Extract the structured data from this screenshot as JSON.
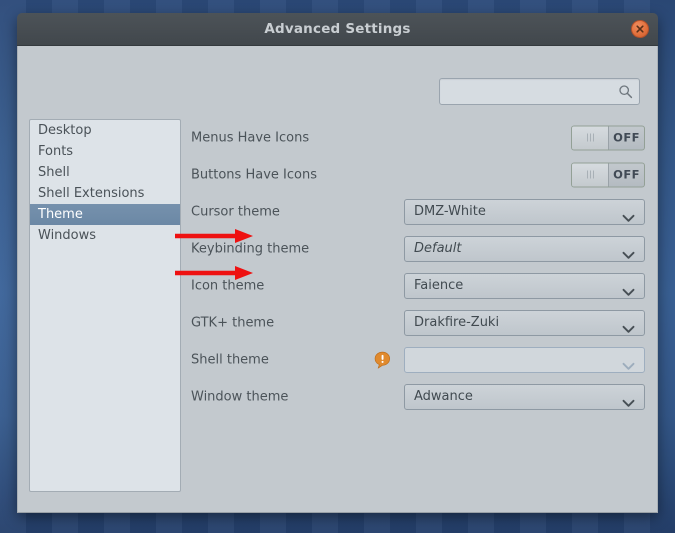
{
  "window": {
    "title": "Advanced Settings",
    "close_icon": "close-icon"
  },
  "search": {
    "value": "",
    "placeholder": "",
    "icon": "search-icon"
  },
  "sidebar": {
    "items": [
      {
        "label": "Desktop",
        "selected": false
      },
      {
        "label": "Fonts",
        "selected": false
      },
      {
        "label": "Shell",
        "selected": false
      },
      {
        "label": "Shell Extensions",
        "selected": false
      },
      {
        "label": "Theme",
        "selected": true
      },
      {
        "label": "Windows",
        "selected": false
      }
    ]
  },
  "settings": {
    "rows": [
      {
        "label": "Menus Have Icons",
        "type": "toggle",
        "state": "OFF"
      },
      {
        "label": "Buttons Have Icons",
        "type": "toggle",
        "state": "OFF"
      },
      {
        "label": "Cursor theme",
        "type": "dropdown",
        "value": "DMZ-White"
      },
      {
        "label": "Keybinding theme",
        "type": "dropdown",
        "value": "Default",
        "italic": true
      },
      {
        "label": "Icon theme",
        "type": "dropdown",
        "value": "Faience",
        "arrow": true
      },
      {
        "label": "GTK+ theme",
        "type": "dropdown",
        "value": "Drakfire-Zuki",
        "arrow": true
      },
      {
        "label": "Shell theme",
        "type": "dropdown",
        "value": "",
        "disabled": true,
        "warning": "warning-icon"
      },
      {
        "label": "Window theme",
        "type": "dropdown",
        "value": "Adwance"
      }
    ]
  },
  "colors": {
    "accent_selection": "#6b88a5",
    "window_body": "#c3c9ce",
    "titlebar": "#474d52",
    "close_button": "#e2713d",
    "warning": "#e08a2e",
    "annotation_arrow": "#ee1111"
  }
}
